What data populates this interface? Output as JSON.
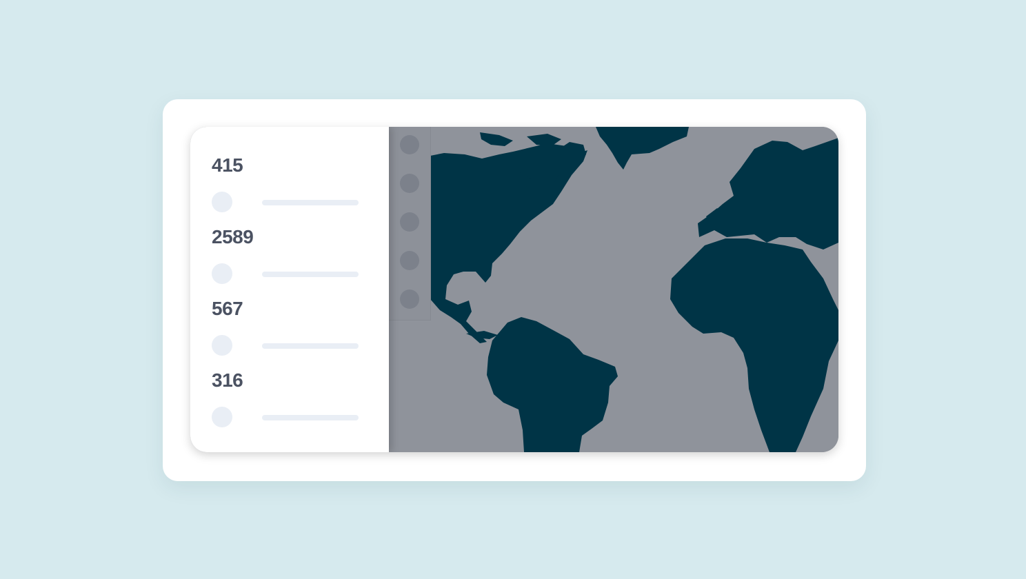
{
  "stats": [
    {
      "value": "415"
    },
    {
      "value": "2589"
    },
    {
      "value": "567"
    },
    {
      "value": "316"
    }
  ],
  "map": {
    "land_color": "#003446",
    "water_color": "#8f939b"
  },
  "colors": {
    "background": "#d6eaee",
    "card": "#ffffff",
    "placeholder": "#e9eef5",
    "stat_text": "#4b5262"
  }
}
